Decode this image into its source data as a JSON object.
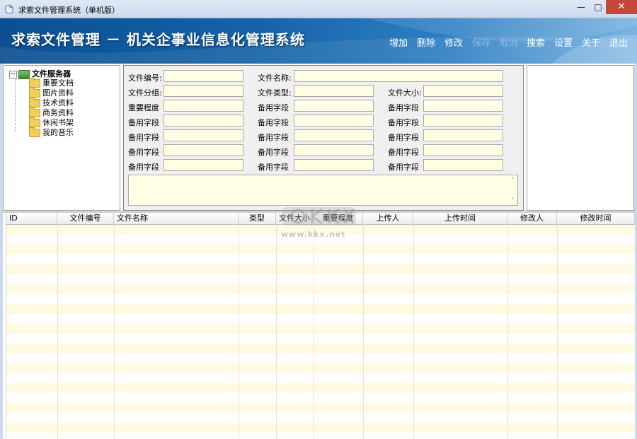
{
  "window": {
    "title": "求索文件管理系统（单机版）",
    "min_glyph": "—",
    "max_glyph": "□",
    "close_glyph": "✕"
  },
  "banner": {
    "title": "求索文件管理 － 机关企事业信息化管理系统"
  },
  "toolbar": {
    "items": [
      {
        "label": "增加",
        "enabled": true
      },
      {
        "label": "删除",
        "enabled": true
      },
      {
        "label": "修改",
        "enabled": true
      },
      {
        "label": "保存",
        "enabled": false
      },
      {
        "label": "取消",
        "enabled": false
      },
      {
        "label": "搜索",
        "enabled": true
      },
      {
        "label": "设置",
        "enabled": true
      },
      {
        "label": "关于",
        "enabled": true
      },
      {
        "label": "退出",
        "enabled": true
      }
    ]
  },
  "tree": {
    "expander": "−",
    "root": "文件服务器",
    "items": [
      "重要文档",
      "图片资料",
      "技术资料",
      "商务资料",
      "休闲书架",
      "我的音乐"
    ]
  },
  "form": {
    "rows": [
      [
        {
          "label": "文件编号:"
        },
        {
          "label": "文件名称:"
        }
      ],
      [
        {
          "label": "文件分组:"
        },
        {
          "label": "文件类型:"
        },
        {
          "label": "文件大小:"
        }
      ],
      [
        {
          "label": "重要程度"
        },
        {
          "label": "备用字段"
        },
        {
          "label": "备用字段"
        }
      ],
      [
        {
          "label": "备用字段"
        },
        {
          "label": "备用字段"
        },
        {
          "label": "备用字段"
        }
      ],
      [
        {
          "label": "备用字段"
        },
        {
          "label": "备用字段"
        },
        {
          "label": "备用字段"
        }
      ],
      [
        {
          "label": "备用字段"
        },
        {
          "label": "备用字段"
        },
        {
          "label": "备用字段"
        }
      ],
      [
        {
          "label": "备用字段"
        },
        {
          "label": "备用字段"
        },
        {
          "label": "备用字段"
        }
      ]
    ],
    "notes_value": "",
    "scroll_up": "˄",
    "scroll_down": "˅"
  },
  "grid": {
    "columns": [
      "ID",
      "文件编号",
      "文件名称",
      "类型",
      "文件大小",
      "重要程度",
      "上传人",
      "上传时间",
      "修改人",
      "修改时间"
    ],
    "rows": []
  },
  "watermark": {
    "url": "www.kkx.net"
  }
}
